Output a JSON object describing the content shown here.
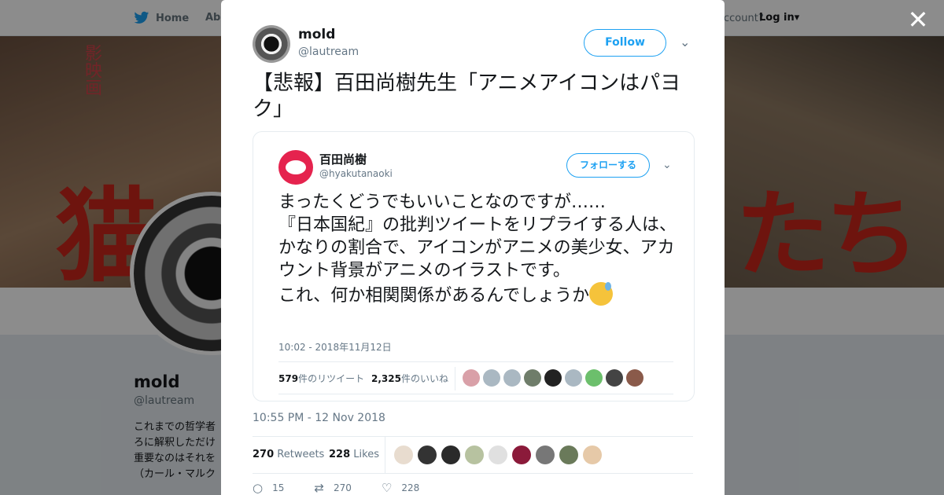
{
  "nav": {
    "home_label": "Home",
    "about_label": "Abo",
    "account_text": "ccount?",
    "login_label": "Log in",
    "login_caret": "▾"
  },
  "banner": {
    "red_left": "猫",
    "red_right": "たち",
    "vertical_text": "影映画"
  },
  "profile": {
    "name": "mold",
    "handle": "@lautream",
    "bio_lines": [
      "これまでの哲学者",
      "ろに解釈しただけ",
      "重要なのはそれを",
      "（カール・マルク"
    ]
  },
  "modal": {
    "close_label": "✕",
    "author_name": "mold",
    "author_handle": "@lautream",
    "follow_label": "Follow",
    "tweet_text": "【悲報】百田尚樹先生「アニメアイコンはパヨク」",
    "quote": {
      "name": "百田尚樹",
      "handle": "@hyakutanaoki",
      "follow_label": "フォローする",
      "text": "まったくどうでもいいことなのですが……\n『日本国紀』の批判ツイートをリプライする人は、かなりの割合で、アイコンがアニメの美少女、アカウント背景がアニメのイラストです。\nこれ、何か相関関係があるんでしょうか",
      "time": "10:02 - 2018年11月12日",
      "retweet_count": "579",
      "retweet_label": "件のリツイート",
      "like_count": "2,325",
      "like_label": "件のいいね"
    },
    "date": "10:55 PM - 12 Nov 2018",
    "retweets_count": "270",
    "retweets_label": "Retweets",
    "likes_count": "228",
    "likes_label": "Likes",
    "actions": {
      "reply": "15",
      "retweet": "270",
      "like": "228"
    }
  },
  "colors": {
    "accent": "#1da1f2",
    "quote_avatar": "#e5234e",
    "overlay": "rgba(0,0,0,0.45)"
  }
}
